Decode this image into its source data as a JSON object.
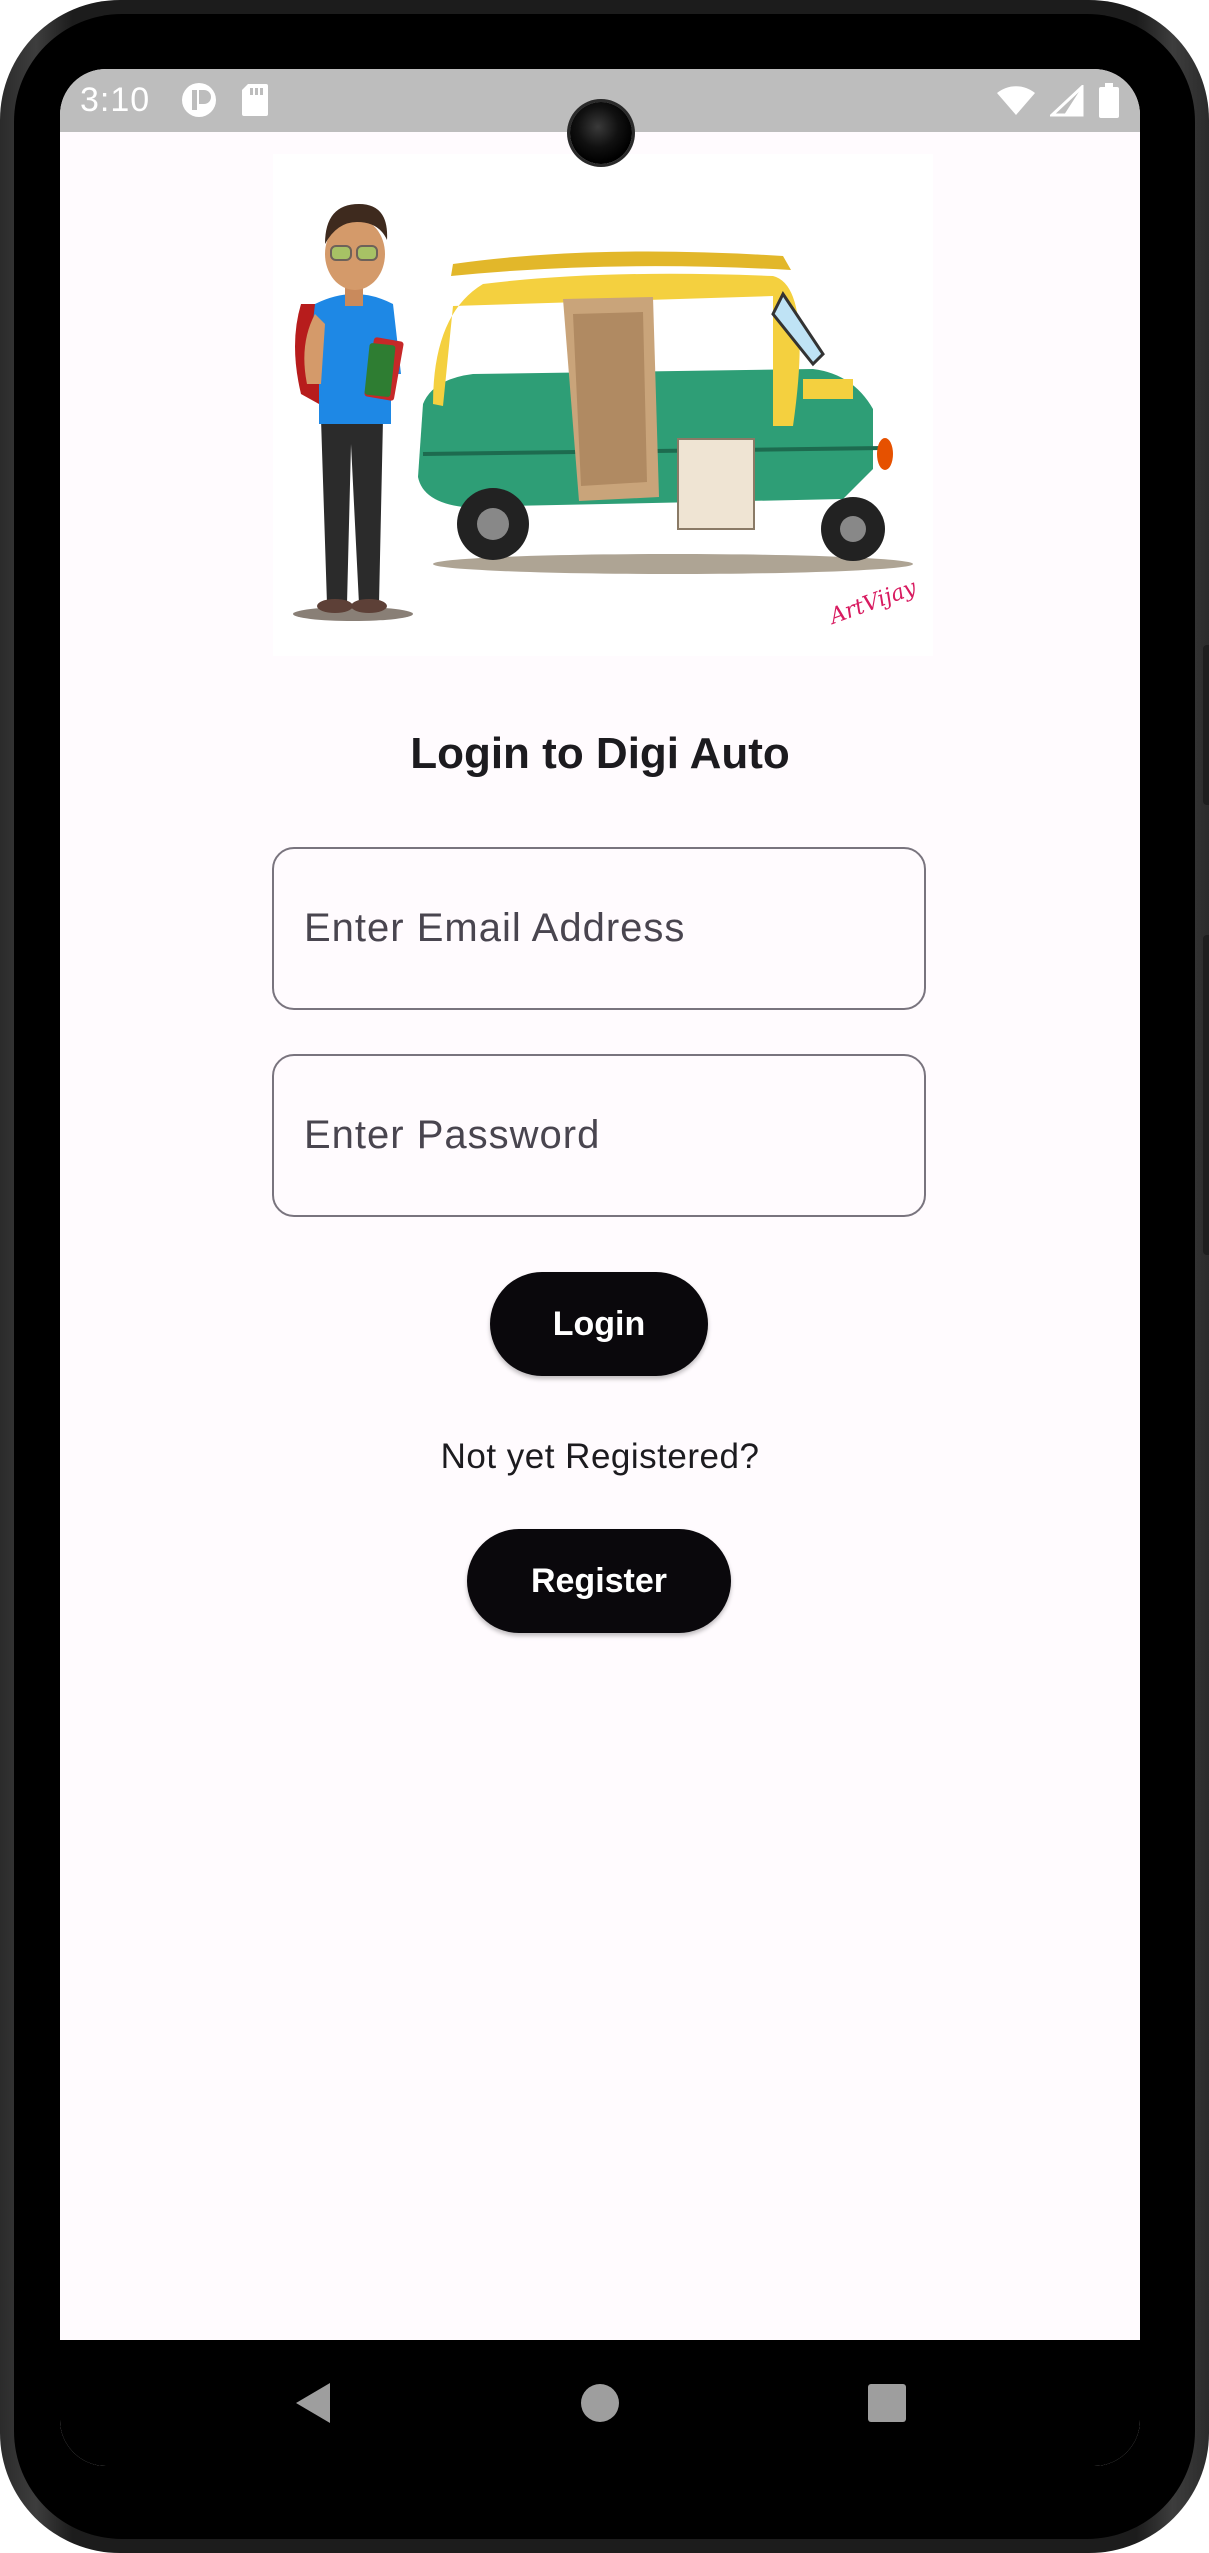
{
  "status_bar": {
    "time": "3:10",
    "left_icons": [
      "app-notification-icon",
      "sd-card-icon"
    ],
    "right_icons": [
      "wifi-icon",
      "cellular-signal-icon",
      "battery-icon"
    ]
  },
  "hero": {
    "image": "student-and-auto-rickshaw-illustration",
    "signature": "ArtVijay"
  },
  "login": {
    "title": "Login to Digi Auto",
    "email_placeholder": "Enter Email Address",
    "password_placeholder": "Enter Password",
    "login_button": "Login",
    "register_prompt": "Not yet Registered?",
    "register_button": "Register"
  },
  "nav_bar": {
    "buttons": [
      "back-icon",
      "home-icon",
      "recents-icon"
    ]
  },
  "colors": {
    "background": "#fffbfe",
    "button": "#0a080c",
    "field_border": "#79747e",
    "status_bar": "#bdbdbd"
  }
}
